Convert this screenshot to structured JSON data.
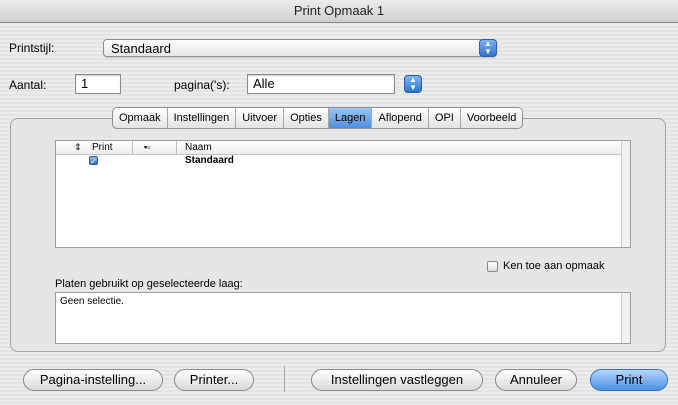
{
  "window": {
    "title": "Print Opmaak 1"
  },
  "style_row": {
    "label": "Printstijl:",
    "value": "Standaard"
  },
  "count_row": {
    "label": "Aantal:",
    "value": "1",
    "pages_label": "pagina('s):",
    "pages_value": "Alle"
  },
  "tabs": [
    "Opmaak",
    "Instellingen",
    "Uitvoer",
    "Opties",
    "Lagen",
    "Aflopend",
    "OPI",
    "Voorbeeld"
  ],
  "active_tab_index": 4,
  "table": {
    "headers": {
      "print": "Print",
      "name": "Naam"
    },
    "rows": [
      {
        "checked": true,
        "name": "Standaard"
      }
    ]
  },
  "apply_checkbox": {
    "label": "Ken toe aan opmaak",
    "checked": false
  },
  "plates": {
    "label": "Platen gebruikt op geselecteerde laag:",
    "value": "Geen selectie."
  },
  "buttons": {
    "page_setup": "Pagina-instelling...",
    "printer": "Printer...",
    "capture": "Instellingen vastleggen",
    "cancel": "Annuleer",
    "print": "Print"
  },
  "icons": [
    "stepper-up-down-icon",
    "checkmark-icon",
    "layer-icon"
  ]
}
